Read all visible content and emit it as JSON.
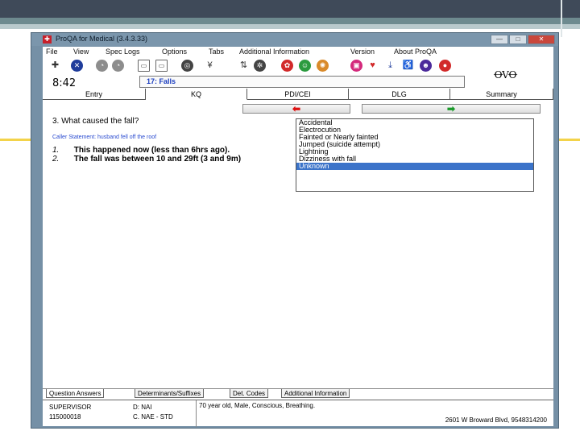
{
  "window": {
    "title": "ProQA for Medical (3.4.3.33)",
    "controls": [
      "—",
      "□",
      "✕"
    ]
  },
  "menu": [
    "File",
    "View",
    "Spec Logs",
    "Options",
    "Tabs",
    "Additional Information",
    "Version",
    "About ProQA"
  ],
  "header": {
    "clock": "8:42",
    "protocol": "17:  Falls",
    "logo_text": "ꝊVꝊ"
  },
  "tabs": [
    "Entry",
    "KQ",
    "PDI/CEI",
    "DLG",
    "Summary"
  ],
  "nav": {
    "back_symbol": "⬅",
    "forward_symbol": "➡"
  },
  "question": {
    "text": "3.   What caused the fall?",
    "caller_statement": "Caller Statement: husband fell off the roof"
  },
  "answers": [
    {
      "num": "1.",
      "text": "This happened now (less than 6hrs ago)."
    },
    {
      "num": "2.",
      "text": "The fall was between 10 and 29ft (3 and 9m)"
    }
  ],
  "dropdown": {
    "options": [
      "Accidental",
      "Electrocution",
      "Fainted or Nearly fainted",
      "Jumped (suicide attempt)",
      "Lightning",
      "Dizziness with fall",
      "Unknown"
    ],
    "selected_index": 6
  },
  "bottom_tabs": [
    "Question Answers",
    "Determinants/Suffixes",
    "Det. Codes",
    "Additional Information"
  ],
  "status": {
    "role": "SUPERVISOR",
    "id": "115000018",
    "code1": "D: NAI",
    "code2": "C. NAE - STD",
    "summary": "70 year old, Male, Conscious, Breathing.",
    "address": "2601 W Broward Blvd, 9548314200"
  },
  "colors": {
    "slide_top": "#3f4a59",
    "window_frame": "#7590a6",
    "selection": "#3b73c9",
    "protocol_text": "#1a3dbf",
    "caller_statement": "#2a4bd0",
    "back_arrow": "#d11111",
    "forward_arrow": "#1a9a2a"
  }
}
